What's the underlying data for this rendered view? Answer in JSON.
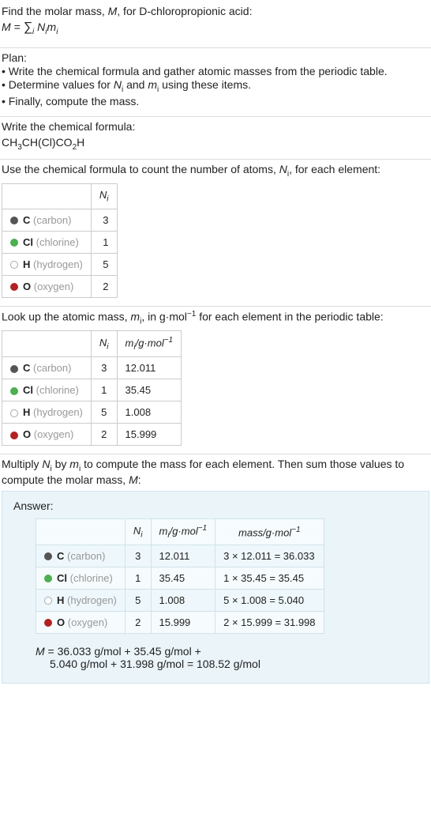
{
  "intro": {
    "line1_a": "Find the molar mass, ",
    "line1_b": "M",
    "line1_c": ", for D-chloropropionic acid:",
    "formula_html": "M = ∑<sub>i</sub> N<sub>i</sub>m<sub>i</sub>"
  },
  "plan": {
    "heading": "Plan:",
    "item1": "• Write the chemical formula and gather atomic masses from the periodic table.",
    "item2_a": "• Determine values for ",
    "item2_b": "N",
    "item2_c": " and ",
    "item2_d": "m",
    "item2_e": " using these items.",
    "item3": "• Finally, compute the mass."
  },
  "chem_section": {
    "heading": "Write the chemical formula:",
    "formula": "CH",
    "p1": "3",
    "mid": "CH(Cl)CO",
    "p2": "2",
    "end": "H"
  },
  "count_section": {
    "heading_a": "Use the chemical formula to count the number of atoms, ",
    "heading_b": "N",
    "heading_c": ", for each element:",
    "col_n": "N",
    "rows": [
      {
        "dot": "#555",
        "border": "#555",
        "sym": "C",
        "name": "(carbon)",
        "n": "3"
      },
      {
        "dot": "#4caf50",
        "border": "#4caf50",
        "sym": "Cl",
        "name": "(chlorine)",
        "n": "1"
      },
      {
        "dot": "#fff",
        "border": "#aaa",
        "sym": "H",
        "name": "(hydrogen)",
        "n": "5"
      },
      {
        "dot": "#b22222",
        "border": "#b22222",
        "sym": "O",
        "name": "(oxygen)",
        "n": "2"
      }
    ]
  },
  "mass_section": {
    "heading_a": "Look up the atomic mass, ",
    "heading_b": "m",
    "heading_c": ", in g·mol",
    "heading_d": "−1",
    "heading_e": " for each element in the periodic table:",
    "col_n": "N",
    "col_m_a": "m",
    "col_m_b": "/g·mol",
    "col_m_c": "−1",
    "rows": [
      {
        "dot": "#555",
        "border": "#555",
        "sym": "C",
        "name": "(carbon)",
        "n": "3",
        "m": "12.011"
      },
      {
        "dot": "#4caf50",
        "border": "#4caf50",
        "sym": "Cl",
        "name": "(chlorine)",
        "n": "1",
        "m": "35.45"
      },
      {
        "dot": "#fff",
        "border": "#aaa",
        "sym": "H",
        "name": "(hydrogen)",
        "n": "5",
        "m": "1.008"
      },
      {
        "dot": "#b22222",
        "border": "#b22222",
        "sym": "O",
        "name": "(oxygen)",
        "n": "2",
        "m": "15.999"
      }
    ]
  },
  "multiply_section": {
    "heading_a": "Multiply ",
    "heading_b": "N",
    "heading_c": " by ",
    "heading_d": "m",
    "heading_e": " to compute the mass for each element. Then sum those values to compute the molar mass, ",
    "heading_f": "M",
    "heading_g": ":"
  },
  "answer": {
    "title": "Answer:",
    "col_n": "N",
    "col_m_a": "m",
    "col_m_b": "/g·mol",
    "col_m_c": "−1",
    "col_mass_a": "mass/g·mol",
    "col_mass_b": "−1",
    "rows": [
      {
        "dot": "#555",
        "border": "#555",
        "sym": "C",
        "name": "(carbon)",
        "n": "3",
        "m": "12.011",
        "mass": "3 × 12.011 = 36.033"
      },
      {
        "dot": "#4caf50",
        "border": "#4caf50",
        "sym": "Cl",
        "name": "(chlorine)",
        "n": "1",
        "m": "35.45",
        "mass": "1 × 35.45 = 35.45"
      },
      {
        "dot": "#fff",
        "border": "#aaa",
        "sym": "H",
        "name": "(hydrogen)",
        "n": "5",
        "m": "1.008",
        "mass": "5 × 1.008 = 5.040"
      },
      {
        "dot": "#b22222",
        "border": "#b22222",
        "sym": "O",
        "name": "(oxygen)",
        "n": "2",
        "m": "15.999",
        "mass": "2 × 15.999 = 31.998"
      }
    ],
    "result_line1_a": "M",
    "result_line1_b": " = 36.033 g/mol + 35.45 g/mol +",
    "result_line2": "5.040 g/mol + 31.998 g/mol = 108.52 g/mol"
  }
}
